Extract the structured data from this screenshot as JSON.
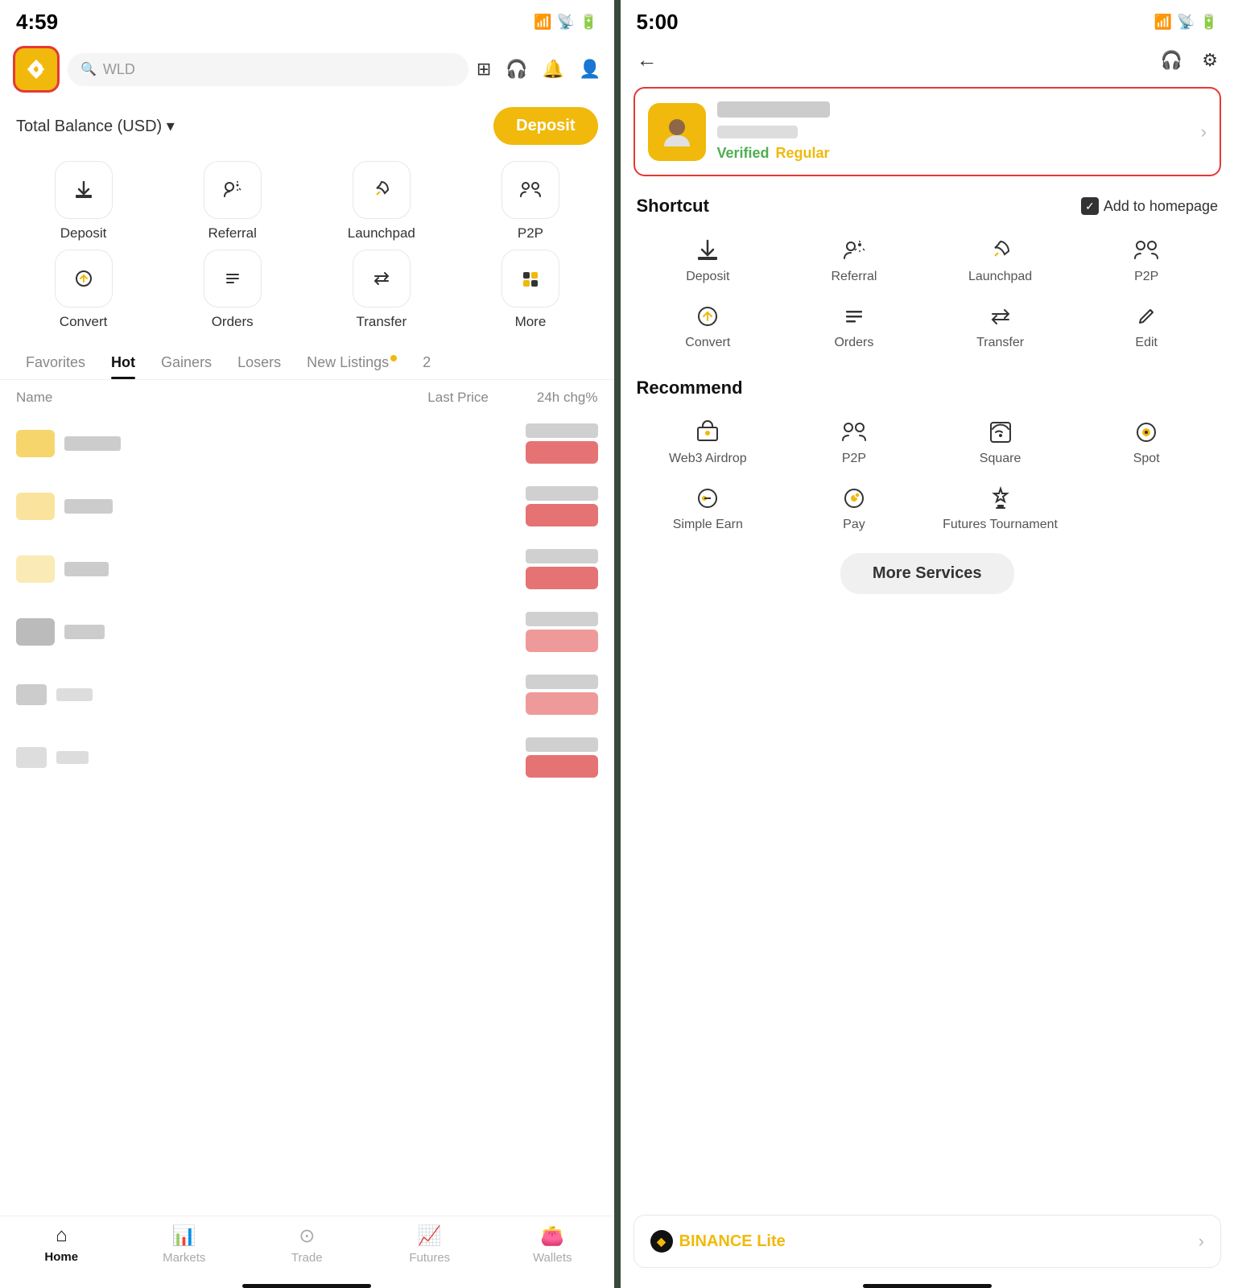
{
  "left": {
    "statusBar": {
      "time": "4:59",
      "locationIcon": "▲",
      "signal": "▂▄▆█",
      "wifi": "◉",
      "battery": "▬"
    },
    "header": {
      "logoAlt": "Binance logo",
      "searchPlaceholder": "WLD",
      "icons": [
        "scan-icon",
        "headset-icon",
        "bell-icon",
        "profile-icon"
      ]
    },
    "balance": {
      "label": "Total Balance (USD)",
      "chevron": "▾",
      "depositLabel": "Deposit"
    },
    "quickActions": [
      {
        "icon": "⬇",
        "label": "Deposit"
      },
      {
        "icon": "👤+",
        "label": "Referral"
      },
      {
        "icon": "🚀",
        "label": "Launchpad"
      },
      {
        "icon": "👥",
        "label": "P2P"
      },
      {
        "icon": "↺",
        "label": "Convert"
      },
      {
        "icon": "≡",
        "label": "Orders"
      },
      {
        "icon": "⇄",
        "label": "Transfer"
      },
      {
        "icon": "⋮⋮",
        "label": "More"
      }
    ],
    "tabs": [
      "Favorites",
      "Hot",
      "Gainers",
      "Losers",
      "New Listings"
    ],
    "activeTab": "Hot",
    "tableHeaders": {
      "name": "Name",
      "lastPrice": "Last Price",
      "change": "24h chg%"
    },
    "nav": [
      {
        "icon": "⌂",
        "label": "Home",
        "active": true
      },
      {
        "icon": "📊",
        "label": "Markets",
        "active": false
      },
      {
        "icon": "●",
        "label": "Trade",
        "active": false
      },
      {
        "icon": "📈",
        "label": "Futures",
        "active": false
      },
      {
        "icon": "👛",
        "label": "Wallets",
        "active": false
      }
    ]
  },
  "right": {
    "statusBar": {
      "time": "5:00",
      "locationIcon": "▲"
    },
    "profile": {
      "verified": "Verified",
      "regular": "Regular"
    },
    "shortcut": {
      "title": "Shortcut",
      "addToHomepage": "Add to homepage",
      "items": [
        {
          "icon": "⬇",
          "label": "Deposit"
        },
        {
          "icon": "👤",
          "label": "Referral"
        },
        {
          "icon": "🚀",
          "label": "Launchpad"
        },
        {
          "icon": "👥",
          "label": "P2P"
        },
        {
          "icon": "↺",
          "label": "Convert"
        },
        {
          "icon": "≡",
          "label": "Orders"
        },
        {
          "icon": "⇄",
          "label": "Transfer"
        },
        {
          "icon": "✎",
          "label": "Edit"
        }
      ]
    },
    "recommend": {
      "title": "Recommend",
      "items": [
        {
          "icon": "🌐",
          "label": "Web3 Airdrop"
        },
        {
          "icon": "👥",
          "label": "P2P"
        },
        {
          "icon": "📡",
          "label": "Square"
        },
        {
          "icon": "◉",
          "label": "Spot"
        },
        {
          "icon": "💰",
          "label": "Simple Earn"
        },
        {
          "icon": "💳",
          "label": "Pay"
        },
        {
          "icon": "👑",
          "label": "Futures Tournament"
        }
      ]
    },
    "moreServicesLabel": "More Services",
    "binanceLite": {
      "name": "BINANCE",
      "type": "Lite"
    }
  }
}
